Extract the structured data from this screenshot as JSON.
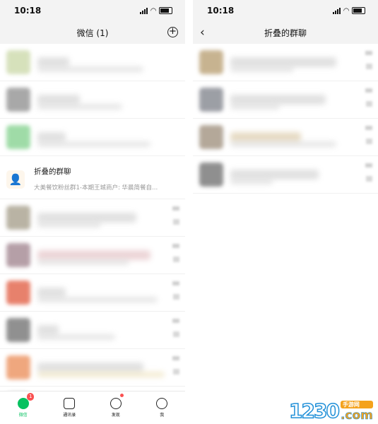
{
  "left_phone": {
    "status_time": "10:18",
    "nav_title": "微信 (1)",
    "folded_group": {
      "title": "折叠的群聊",
      "preview": "大美餐饮粉丝群1-本期王城商户: 华晨简餐自..."
    },
    "tabs": [
      {
        "label": "微信",
        "badge": "1"
      },
      {
        "label": "通讯录"
      },
      {
        "label": "发现"
      },
      {
        "label": "我"
      }
    ]
  },
  "right_phone": {
    "status_time": "10:18",
    "nav_title": "折叠的群聊"
  },
  "watermark": {
    "main": "1230",
    "tag": "手游网",
    "domain": ".com"
  },
  "colors": {
    "accent": "#07c160",
    "badge": "#fa5151",
    "watermark_orange": "#f4a21c",
    "watermark_blue": "#1f8fd8"
  }
}
